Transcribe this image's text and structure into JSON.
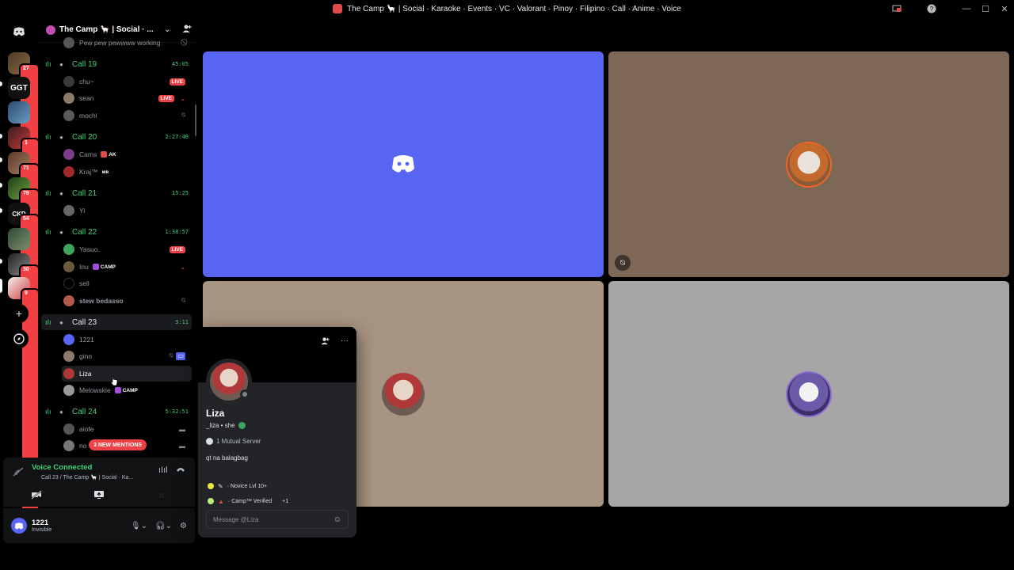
{
  "window": {
    "title": "The Camp 🦙 | Social · Karaoke · Events · VC · Valorant · Pinoy · Filipino · Call · Anime · Voice",
    "controls": [
      "screen-share-icon",
      "help-icon",
      "minimize-icon",
      "maximize-icon",
      "close-icon"
    ]
  },
  "rail": {
    "servers": [
      {
        "badge": "27"
      },
      {
        "badge": ""
      },
      {
        "badge": ""
      },
      {
        "badge": "1"
      },
      {
        "badge": "71"
      },
      {
        "badge": "79"
      },
      {
        "badge": "54"
      },
      {
        "badge": ""
      },
      {
        "badge": "30"
      },
      {
        "badge": "9"
      }
    ]
  },
  "guild": {
    "name": "The Camp 🦙 | Social · ...",
    "top_row_text": "Pew pew pewwww working"
  },
  "channels": [
    {
      "name": "Call 19",
      "duration": "45:05",
      "users": [
        {
          "name": "chu~",
          "live": "LIVE"
        },
        {
          "name": "sean",
          "live": "LIVE"
        },
        {
          "name": "mochi"
        }
      ]
    },
    {
      "name": "Call 20",
      "duration": "2:27:40",
      "users": [
        {
          "name": "Cams",
          "tag": "AK"
        },
        {
          "name": "Kraj™",
          "tag": "ᴍʀ"
        }
      ]
    },
    {
      "name": "Call 21",
      "duration": "15:25",
      "users": [
        {
          "name": "Yi"
        }
      ]
    },
    {
      "name": "Call 22",
      "duration": "1:38:57",
      "users": [
        {
          "name": "Yasuo.",
          "live": "LIVE"
        },
        {
          "name": "Inu",
          "tag": "CAMP"
        },
        {
          "name": "sell"
        },
        {
          "name": "stew bedasso"
        }
      ]
    },
    {
      "name": "Call 23",
      "duration": "3:11",
      "users": [
        {
          "name": "1221"
        },
        {
          "name": "ginn"
        },
        {
          "name": "Liza"
        },
        {
          "name": "Melowskie",
          "tag": "CAMP"
        }
      ]
    },
    {
      "name": "Call 24",
      "duration": "5:32:51",
      "users": [
        {
          "name": "aiofe"
        },
        {
          "name": "no"
        }
      ]
    }
  ],
  "mentions_label": "3 NEW MENTIONS",
  "voice": {
    "title": "Voice Connected",
    "subtitle": "Call 23 / The Camp 🦙 | Social · Ka..."
  },
  "user": {
    "name": "1221",
    "status": "Invisible"
  },
  "tiles": [
    {
      "bg": "#5865f2",
      "kind": "discord-logo"
    },
    {
      "bg": "#7d6858",
      "kind": "avatar"
    },
    {
      "bg": "#a89482",
      "kind": "avatar"
    },
    {
      "bg": "#a7a6a6",
      "kind": "avatar"
    }
  ],
  "profile": {
    "name": "Liza",
    "handle": "_liza • she",
    "mutual": "1 Mutual Server",
    "bio": "qt na balagbag",
    "roles": [
      {
        "label": "· Novice Lvl 10+",
        "color": "#f0e442"
      },
      {
        "label": "· Camp™ Verified",
        "color": "#b8f07a",
        "extra": "+1"
      }
    ],
    "message_placeholder": "Message @Liza"
  }
}
